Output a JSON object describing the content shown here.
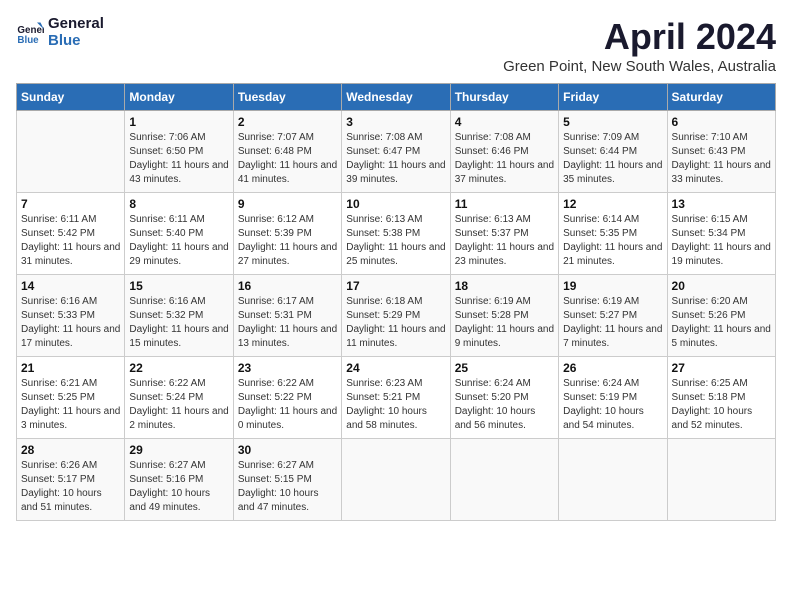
{
  "logo": {
    "line1": "General",
    "line2": "Blue"
  },
  "title": "April 2024",
  "location": "Green Point, New South Wales, Australia",
  "days_of_week": [
    "Sunday",
    "Monday",
    "Tuesday",
    "Wednesday",
    "Thursday",
    "Friday",
    "Saturday"
  ],
  "weeks": [
    [
      {
        "day": "",
        "sunrise": "",
        "sunset": "",
        "daylight": ""
      },
      {
        "day": "1",
        "sunrise": "Sunrise: 7:06 AM",
        "sunset": "Sunset: 6:50 PM",
        "daylight": "Daylight: 11 hours and 43 minutes."
      },
      {
        "day": "2",
        "sunrise": "Sunrise: 7:07 AM",
        "sunset": "Sunset: 6:48 PM",
        "daylight": "Daylight: 11 hours and 41 minutes."
      },
      {
        "day": "3",
        "sunrise": "Sunrise: 7:08 AM",
        "sunset": "Sunset: 6:47 PM",
        "daylight": "Daylight: 11 hours and 39 minutes."
      },
      {
        "day": "4",
        "sunrise": "Sunrise: 7:08 AM",
        "sunset": "Sunset: 6:46 PM",
        "daylight": "Daylight: 11 hours and 37 minutes."
      },
      {
        "day": "5",
        "sunrise": "Sunrise: 7:09 AM",
        "sunset": "Sunset: 6:44 PM",
        "daylight": "Daylight: 11 hours and 35 minutes."
      },
      {
        "day": "6",
        "sunrise": "Sunrise: 7:10 AM",
        "sunset": "Sunset: 6:43 PM",
        "daylight": "Daylight: 11 hours and 33 minutes."
      }
    ],
    [
      {
        "day": "7",
        "sunrise": "Sunrise: 6:11 AM",
        "sunset": "Sunset: 5:42 PM",
        "daylight": "Daylight: 11 hours and 31 minutes."
      },
      {
        "day": "8",
        "sunrise": "Sunrise: 6:11 AM",
        "sunset": "Sunset: 5:40 PM",
        "daylight": "Daylight: 11 hours and 29 minutes."
      },
      {
        "day": "9",
        "sunrise": "Sunrise: 6:12 AM",
        "sunset": "Sunset: 5:39 PM",
        "daylight": "Daylight: 11 hours and 27 minutes."
      },
      {
        "day": "10",
        "sunrise": "Sunrise: 6:13 AM",
        "sunset": "Sunset: 5:38 PM",
        "daylight": "Daylight: 11 hours and 25 minutes."
      },
      {
        "day": "11",
        "sunrise": "Sunrise: 6:13 AM",
        "sunset": "Sunset: 5:37 PM",
        "daylight": "Daylight: 11 hours and 23 minutes."
      },
      {
        "day": "12",
        "sunrise": "Sunrise: 6:14 AM",
        "sunset": "Sunset: 5:35 PM",
        "daylight": "Daylight: 11 hours and 21 minutes."
      },
      {
        "day": "13",
        "sunrise": "Sunrise: 6:15 AM",
        "sunset": "Sunset: 5:34 PM",
        "daylight": "Daylight: 11 hours and 19 minutes."
      }
    ],
    [
      {
        "day": "14",
        "sunrise": "Sunrise: 6:16 AM",
        "sunset": "Sunset: 5:33 PM",
        "daylight": "Daylight: 11 hours and 17 minutes."
      },
      {
        "day": "15",
        "sunrise": "Sunrise: 6:16 AM",
        "sunset": "Sunset: 5:32 PM",
        "daylight": "Daylight: 11 hours and 15 minutes."
      },
      {
        "day": "16",
        "sunrise": "Sunrise: 6:17 AM",
        "sunset": "Sunset: 5:31 PM",
        "daylight": "Daylight: 11 hours and 13 minutes."
      },
      {
        "day": "17",
        "sunrise": "Sunrise: 6:18 AM",
        "sunset": "Sunset: 5:29 PM",
        "daylight": "Daylight: 11 hours and 11 minutes."
      },
      {
        "day": "18",
        "sunrise": "Sunrise: 6:19 AM",
        "sunset": "Sunset: 5:28 PM",
        "daylight": "Daylight: 11 hours and 9 minutes."
      },
      {
        "day": "19",
        "sunrise": "Sunrise: 6:19 AM",
        "sunset": "Sunset: 5:27 PM",
        "daylight": "Daylight: 11 hours and 7 minutes."
      },
      {
        "day": "20",
        "sunrise": "Sunrise: 6:20 AM",
        "sunset": "Sunset: 5:26 PM",
        "daylight": "Daylight: 11 hours and 5 minutes."
      }
    ],
    [
      {
        "day": "21",
        "sunrise": "Sunrise: 6:21 AM",
        "sunset": "Sunset: 5:25 PM",
        "daylight": "Daylight: 11 hours and 3 minutes."
      },
      {
        "day": "22",
        "sunrise": "Sunrise: 6:22 AM",
        "sunset": "Sunset: 5:24 PM",
        "daylight": "Daylight: 11 hours and 2 minutes."
      },
      {
        "day": "23",
        "sunrise": "Sunrise: 6:22 AM",
        "sunset": "Sunset: 5:22 PM",
        "daylight": "Daylight: 11 hours and 0 minutes."
      },
      {
        "day": "24",
        "sunrise": "Sunrise: 6:23 AM",
        "sunset": "Sunset: 5:21 PM",
        "daylight": "Daylight: 10 hours and 58 minutes."
      },
      {
        "day": "25",
        "sunrise": "Sunrise: 6:24 AM",
        "sunset": "Sunset: 5:20 PM",
        "daylight": "Daylight: 10 hours and 56 minutes."
      },
      {
        "day": "26",
        "sunrise": "Sunrise: 6:24 AM",
        "sunset": "Sunset: 5:19 PM",
        "daylight": "Daylight: 10 hours and 54 minutes."
      },
      {
        "day": "27",
        "sunrise": "Sunrise: 6:25 AM",
        "sunset": "Sunset: 5:18 PM",
        "daylight": "Daylight: 10 hours and 52 minutes."
      }
    ],
    [
      {
        "day": "28",
        "sunrise": "Sunrise: 6:26 AM",
        "sunset": "Sunset: 5:17 PM",
        "daylight": "Daylight: 10 hours and 51 minutes."
      },
      {
        "day": "29",
        "sunrise": "Sunrise: 6:27 AM",
        "sunset": "Sunset: 5:16 PM",
        "daylight": "Daylight: 10 hours and 49 minutes."
      },
      {
        "day": "30",
        "sunrise": "Sunrise: 6:27 AM",
        "sunset": "Sunset: 5:15 PM",
        "daylight": "Daylight: 10 hours and 47 minutes."
      },
      {
        "day": "",
        "sunrise": "",
        "sunset": "",
        "daylight": ""
      },
      {
        "day": "",
        "sunrise": "",
        "sunset": "",
        "daylight": ""
      },
      {
        "day": "",
        "sunrise": "",
        "sunset": "",
        "daylight": ""
      },
      {
        "day": "",
        "sunrise": "",
        "sunset": "",
        "daylight": ""
      }
    ]
  ]
}
